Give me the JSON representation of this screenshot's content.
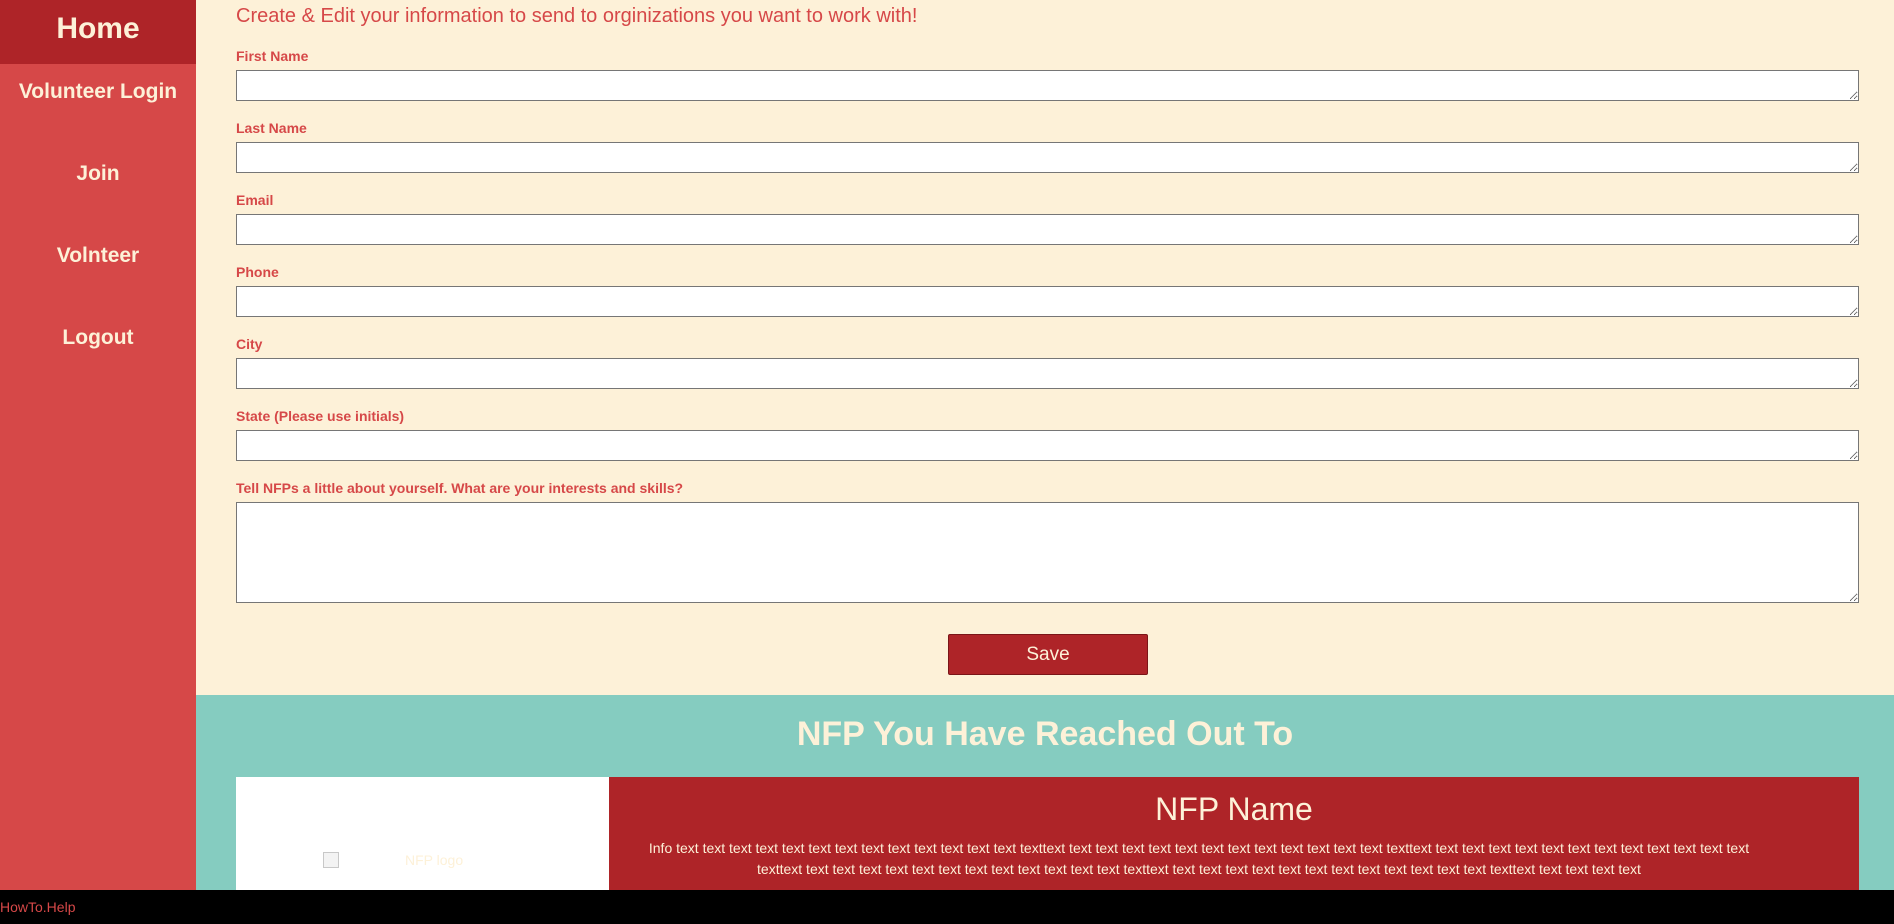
{
  "sidebar": {
    "home": "Home",
    "items": [
      "Volunteer Login",
      "Join",
      "Volnteer",
      "Logout"
    ]
  },
  "form": {
    "intro": "Create & Edit your information to send to orginizations you want to work with!",
    "fields": [
      {
        "label": "First Name",
        "value": ""
      },
      {
        "label": "Last Name",
        "value": ""
      },
      {
        "label": "Email",
        "value": ""
      },
      {
        "label": "Phone",
        "value": ""
      },
      {
        "label": "City",
        "value": ""
      },
      {
        "label": "State (Please use initials)",
        "value": ""
      },
      {
        "label": "Tell NFPs a little about yourself. What are your interests and skills?",
        "value": ""
      }
    ],
    "save_label": "Save"
  },
  "nfp": {
    "title": "NFP You Have Reached Out To",
    "card": {
      "logo_alt": "NFP logo",
      "name": "NFP Name",
      "description": "Info text text text text text text text text text text text text text texttext text text text text text text text text text text text text texttext text text text text text text text text text text text text texttext text text text text text text text text text text text text texttext text text text text text text text text text text text text texttext text text text text"
    }
  },
  "footer": {
    "brand": "HowTo.Help"
  },
  "colors": {
    "cream": "#FDF1D8",
    "red": "#D64848",
    "dark_red": "#AE2428",
    "teal": "#85CCC0"
  }
}
